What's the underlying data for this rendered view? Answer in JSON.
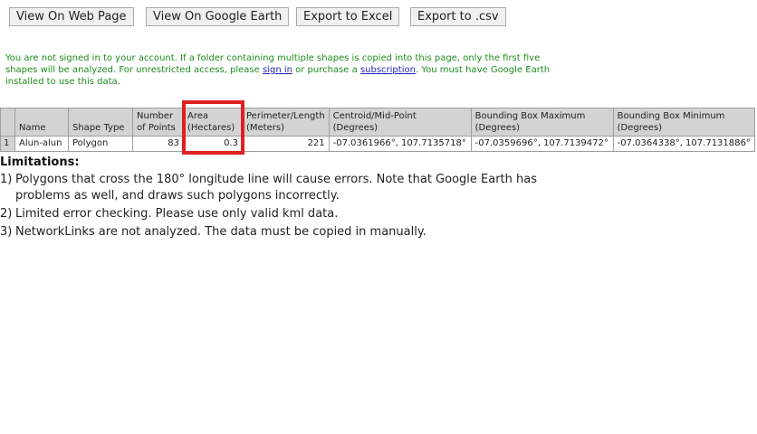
{
  "toolbar": {
    "view_web": "View On Web Page",
    "view_earth": "View On Google Earth",
    "export_excel": "Export to Excel",
    "export_csv": "Export to .csv"
  },
  "notice": {
    "text1": "You are not signed in to your account. If a folder containing multiple shapes is copied into this page, only the first five shapes will be analyzed. For unrestricted access, please ",
    "signin": "sign in",
    "text2": " or purchase a ",
    "subscription": "subscription",
    "text3": ". You must have Google Earth installed to use this data."
  },
  "table": {
    "headers": {
      "name": "Name",
      "shape_type": "Shape Type",
      "points_1": "Number",
      "points_2": "of Points",
      "area_1": "Area",
      "area_2": "(Hectares)",
      "perim_1": "Perimeter/Length",
      "perim_2": "(Meters)",
      "centroid_1": "Centroid/Mid-Point",
      "centroid_2": "(Degrees)",
      "bbmax_1": "Bounding Box Maximum",
      "bbmax_2": "(Degrees)",
      "bbmin_1": "Bounding Box Minimum",
      "bbmin_2": "(Degrees)"
    },
    "rows": [
      {
        "index": "1",
        "name": "Alun-alun",
        "shape_type": "Polygon",
        "points": "83",
        "area": "0.3",
        "perimeter": "221",
        "centroid": "-07.0361966°, 107.7135718°",
        "bbmax": "-07.0359696°, 107.7139472°",
        "bbmin": "-07.0364338°, 107.7131886°"
      }
    ]
  },
  "limitations": {
    "title": "Limitations:",
    "items": [
      {
        "n": "1)",
        "text": "Polygons that cross the 180° longitude line will cause errors. Note that Google Earth has problems as well, and draws such polygons incorrectly."
      },
      {
        "n": "2)",
        "text": "Limited error checking. Please use only valid kml data."
      },
      {
        "n": "3)",
        "text": "NetworkLinks are not analyzed. The data must be copied in manually."
      }
    ]
  },
  "colors": {
    "notice_text": "#1e8a1e",
    "link": "#1f1fbf",
    "highlight": "#e02020",
    "header_bg": "#d3d3d3"
  }
}
